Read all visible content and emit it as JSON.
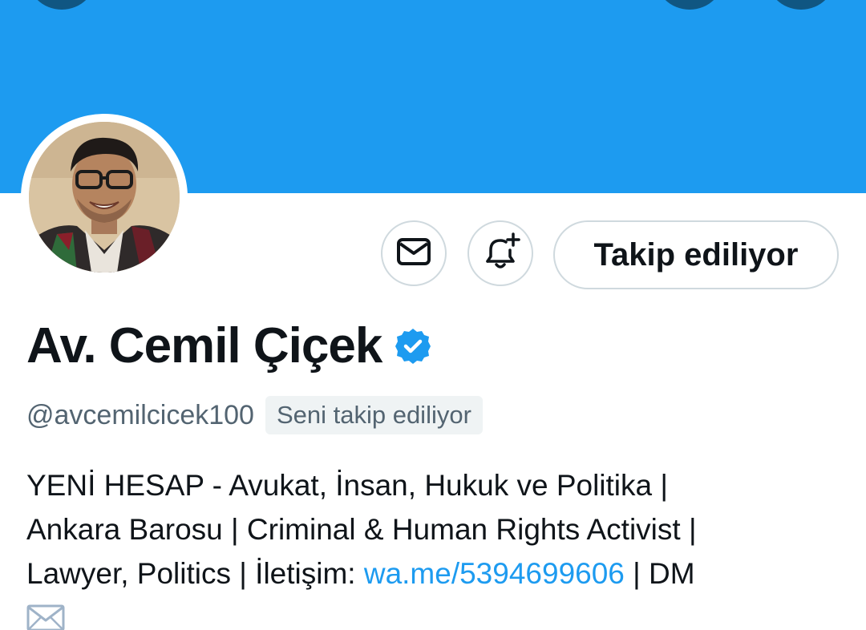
{
  "header": {
    "banner_color": "#1d9bf0"
  },
  "actions": {
    "message_icon": "mail-icon",
    "notify_icon": "bell-plus-icon",
    "follow_label": "Takip ediliyor"
  },
  "profile": {
    "display_name": "Av. Cemil Çiçek",
    "verified": true,
    "handle": "@avcemilcicek100",
    "follows_you_label": "Seni takip ediliyor",
    "bio": {
      "line1": "YENİ HESAP - Avukat, İnsan, Hukuk ve Politika |",
      "line2": "Ankara Barosu | Criminal & Human Rights Activist |",
      "line3_prefix": "Lawyer, Politics | İletişim: ",
      "link_text": "wa.me/5394699606",
      "line3_suffix": " | DM",
      "emoji": "envelope-emoji"
    }
  },
  "colors": {
    "accent": "#1d9bf0",
    "text": "#0f1419",
    "secondary_text": "#536471",
    "border": "#cfd9de"
  }
}
